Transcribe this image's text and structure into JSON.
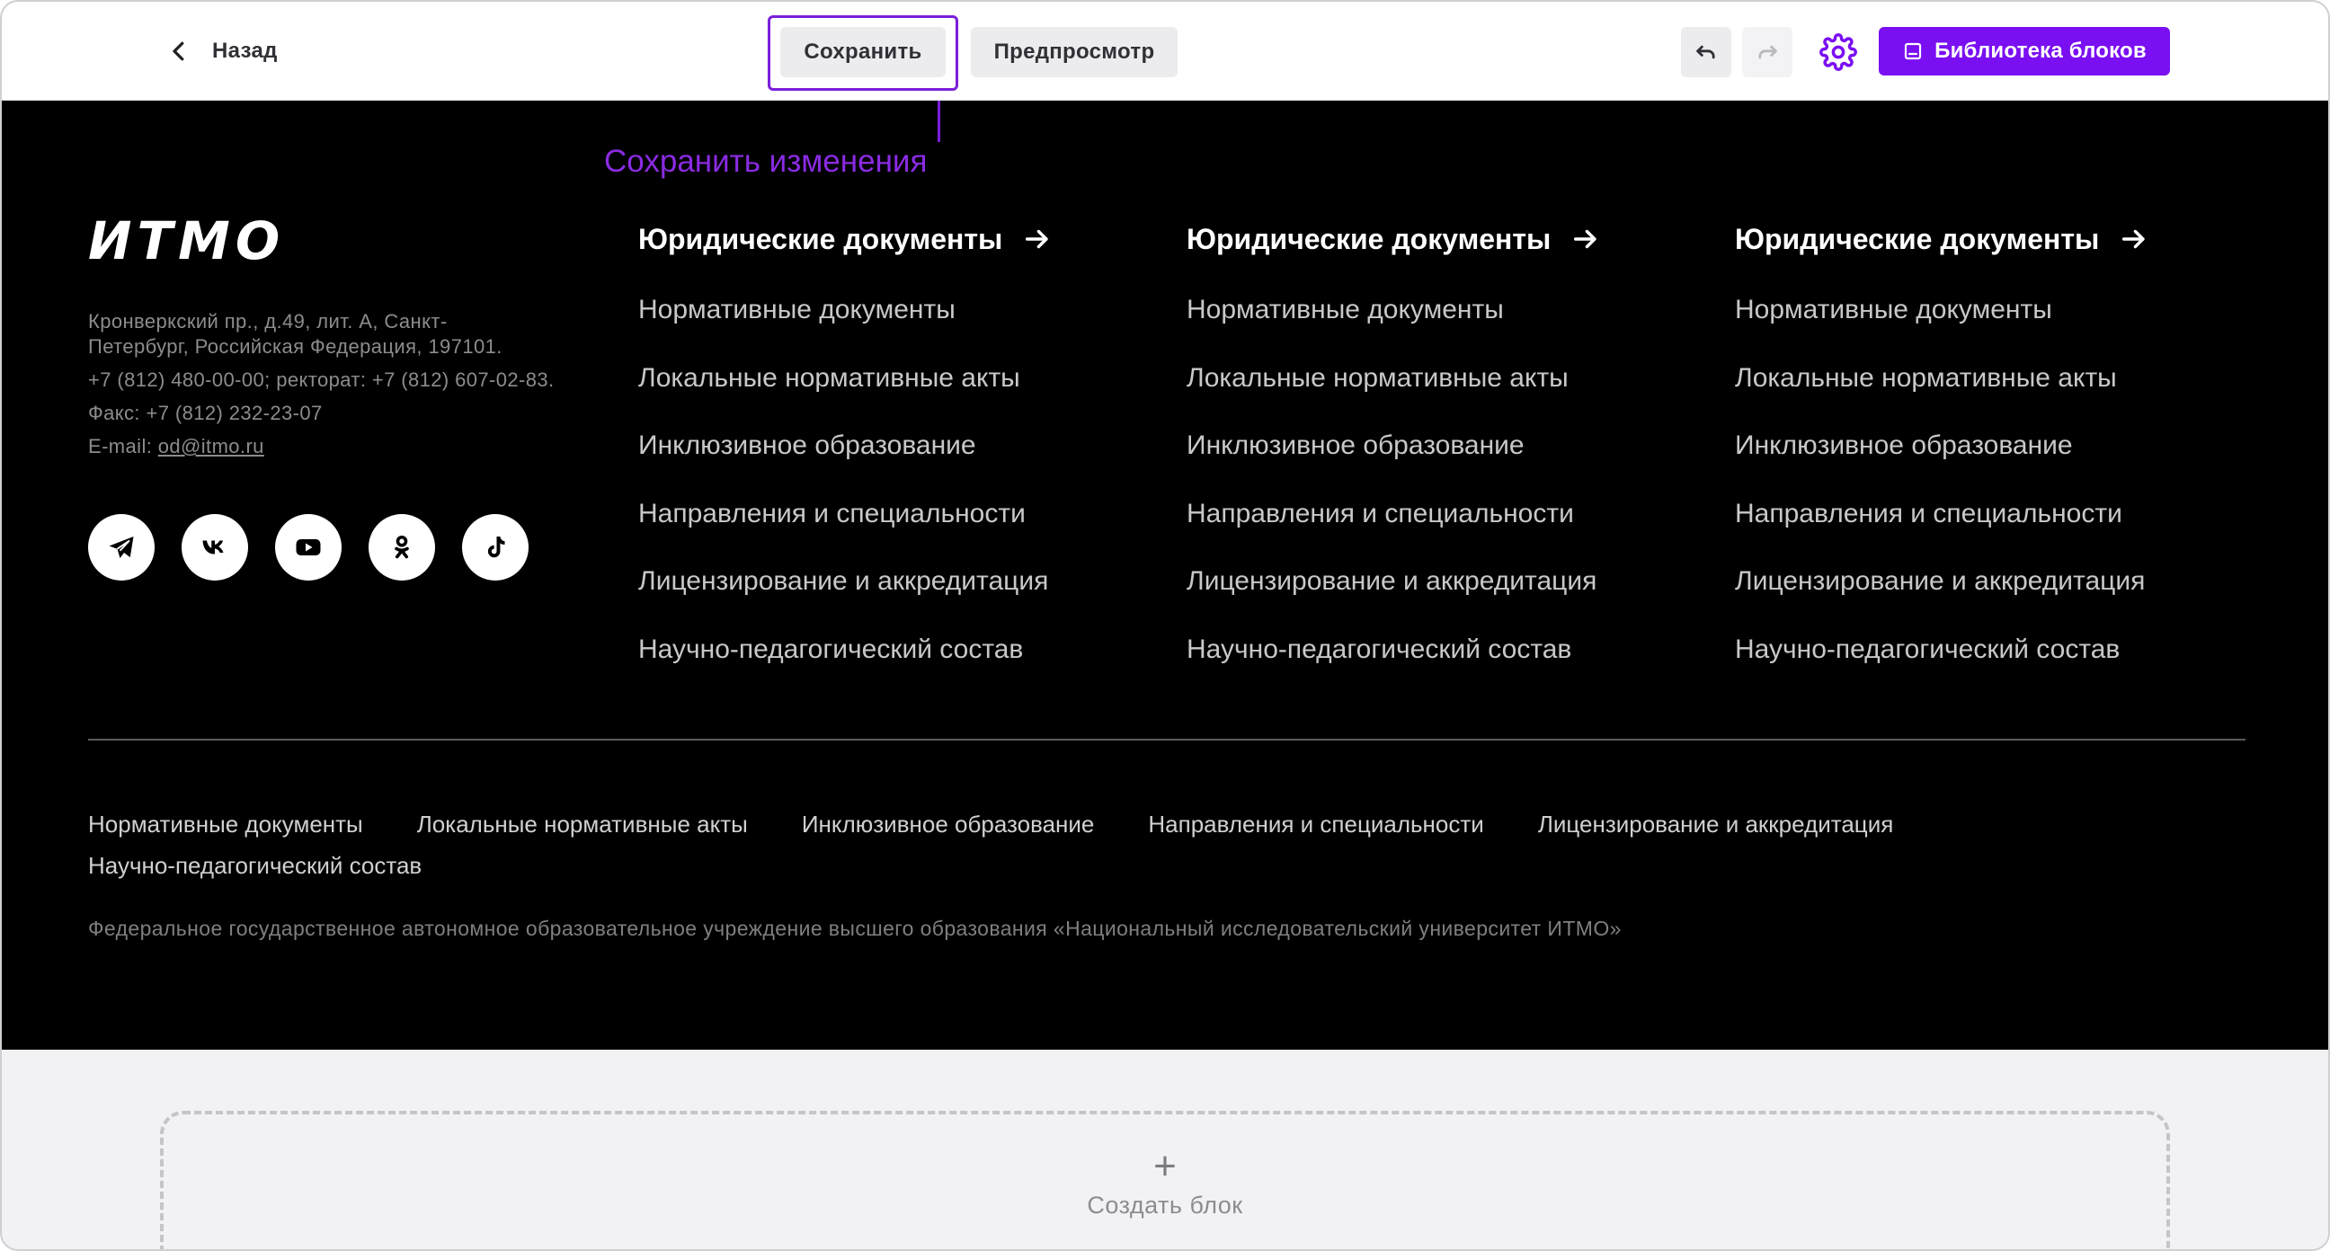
{
  "toolbar": {
    "back_label": "Назад",
    "save_label": "Сохранить",
    "preview_label": "Предпросмотр",
    "library_label": "Библиотека блоков",
    "tooltip": "Сохранить изменения"
  },
  "footer": {
    "logo_text": "ИТМО",
    "address_line_1": "Кронверкский пр., д.49, лит. А, Санкт-",
    "address_line_2": "Петербург, Российская Федерация, 197101.",
    "phones": "+7 (812) 480-00-00; ректорат: +7 (812) 607-02-83.",
    "fax": "Факс: +7 (812) 232-23-07",
    "email_prefix": "E-mail: ",
    "email": "od@itmo.ru",
    "socials": [
      "telegram",
      "vk",
      "youtube",
      "odnoklassniki",
      "tiktok"
    ],
    "columns": [
      {
        "title": "Юридические документы",
        "links": [
          "Нормативные документы",
          "Локальные нормативные акты",
          "Инклюзивное образование",
          "Направления и специальности",
          "Лицензирование и аккредитация",
          "Научно-педагогический состав"
        ]
      },
      {
        "title": "Юридические документы",
        "links": [
          "Нормативные документы",
          "Локальные нормативные акты",
          "Инклюзивное образование",
          "Направления и специальности",
          "Лицензирование и аккредитация",
          "Научно-педагогический состав"
        ]
      },
      {
        "title": "Юридические документы",
        "links": [
          "Нормативные документы",
          "Локальные нормативные акты",
          "Инклюзивное образование",
          "Направления и специальности",
          "Лицензирование и аккредитация",
          "Научно-педагогический состав"
        ]
      }
    ],
    "bottom_links": [
      "Нормативные документы",
      "Локальные нормативные акты",
      "Инклюзивное образование",
      "Направления и специальности",
      "Лицензирование и аккредитация",
      "Научно-педагогический состав"
    ],
    "legal": "Федеральное государственное автономное образовательное учреждение высшего образования «Национальный исследовательский университет ИТМО»"
  },
  "create_block": {
    "plus": "+",
    "label": "Создать блок"
  },
  "colors": {
    "accent": "#7a0ff2",
    "highlight": "#7a1fd9",
    "footer_bg": "#000000"
  }
}
